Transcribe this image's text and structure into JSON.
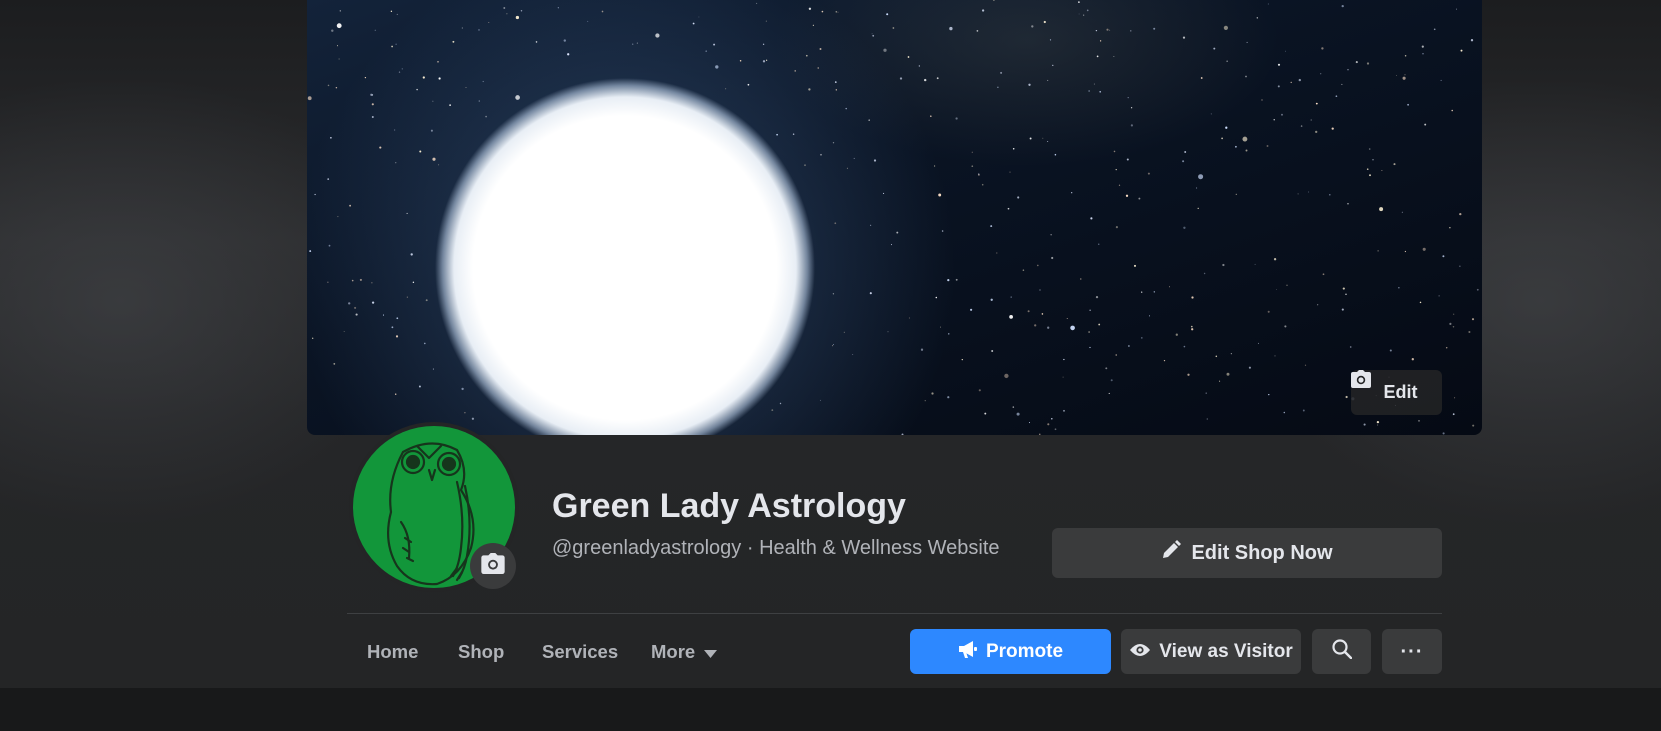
{
  "cover": {
    "edit_label": "Edit"
  },
  "profile": {
    "name": "Green Lady Astrology",
    "subtitle": "@greenladyastrology · Health & Wellness Website",
    "avatar_bg": "#12963a"
  },
  "actions": {
    "edit_shop_label": "Edit Shop Now",
    "promote_label": "Promote",
    "view_as_visitor_label": "View as Visitor",
    "more_dots": "···"
  },
  "tabs": [
    {
      "label": "Home"
    },
    {
      "label": "Shop"
    },
    {
      "label": "Services"
    },
    {
      "label": "More"
    }
  ],
  "colors": {
    "accent": "#2d88ff",
    "surface": "#242526",
    "button": "#3a3b3c",
    "text_primary": "#e4e6eb",
    "text_secondary": "#b0b3b8"
  },
  "icons": {
    "cover_edit": "camera-icon",
    "profile_edit": "camera-icon",
    "edit_shop": "pencil-icon",
    "promote": "megaphone-icon",
    "visitor": "eye-icon",
    "search": "search-icon",
    "more_caret": "caret-down-icon"
  }
}
